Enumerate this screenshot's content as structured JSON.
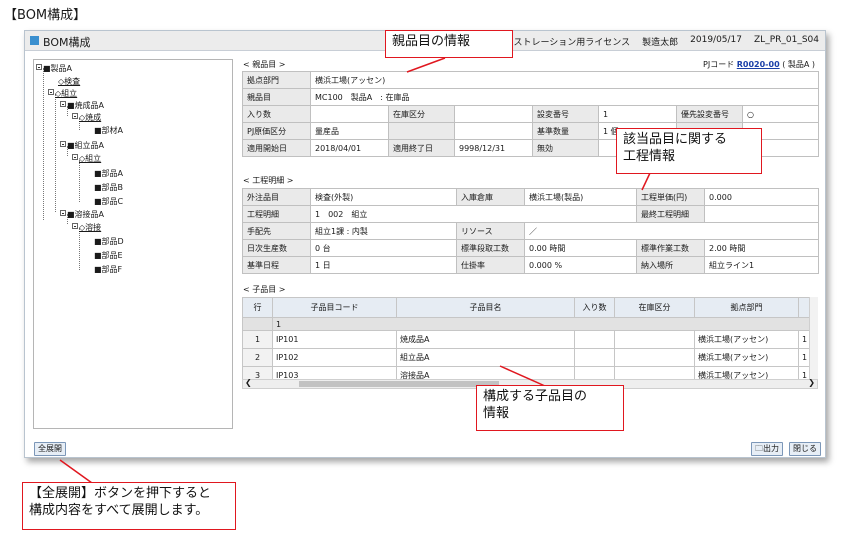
{
  "caption": "【BOM構成】",
  "window": {
    "title": "BOM構成",
    "license": "デモンストレーション用ライセンス",
    "user": "製造太郎",
    "date": "2019/05/17",
    "screen_id": "ZL_PR_01_S04"
  },
  "tree": [
    {
      "label": "■製品A",
      "link": false
    },
    {
      "label": "◇検査",
      "link": true
    },
    {
      "label": "◇組立",
      "link": true
    },
    {
      "label": "■焼成品A",
      "link": false
    },
    {
      "label": "◇焼成",
      "link": true
    },
    {
      "label": "■部材A",
      "link": false
    },
    {
      "label": "■組立品A",
      "link": false
    },
    {
      "label": "◇組立",
      "link": true
    },
    {
      "label": "■部品A",
      "link": false
    },
    {
      "label": "■部品B",
      "link": false
    },
    {
      "label": "■部品C",
      "link": false
    },
    {
      "label": "■溶接品A",
      "link": false
    },
    {
      "label": "◇溶接",
      "link": true
    },
    {
      "label": "■部品D",
      "link": false
    },
    {
      "label": "■部品E",
      "link": false
    },
    {
      "label": "■部品F",
      "link": false
    }
  ],
  "parent": {
    "section": "< 親品目 >",
    "pj_label": "PJコード",
    "pj_code": "R0020-00",
    "pj_suffix": "( 製品A )",
    "rows": [
      [
        "拠点部門",
        "横浜工場(アッセン)"
      ],
      [
        "親品目",
        "MC100　製品A　: 在庫品"
      ],
      [
        "入り数",
        "",
        "在庫区分",
        "",
        "設変番号",
        "1",
        "優先設変番号",
        "○"
      ],
      [
        "PJ原価区分",
        "量産品",
        "",
        "",
        "基準数量",
        "1 個",
        "",
        ""
      ],
      [
        "適用開始日",
        "2018/04/01",
        "適用終了日",
        "9998/12/31",
        "無効",
        "",
        "",
        ""
      ]
    ]
  },
  "process": {
    "section": "< 工程明細 >",
    "rows": [
      [
        "外注品目",
        "検査(外製)",
        "入庫倉庫",
        "横浜工場(製品)",
        "工程単価(円)",
        "0.000"
      ],
      [
        "工程明細",
        "1　002　組立",
        "",
        "",
        "最終工程明細",
        ""
      ],
      [
        "手配先",
        "組立1課 : 内製",
        "リソース",
        "／",
        "",
        ""
      ],
      [
        "日次生産数",
        "0 台",
        "標準段取工数",
        "0.00 時間",
        "標準作業工数",
        "2.00 時間"
      ],
      [
        "基準日程",
        "1 日",
        "仕掛率",
        "0.000 %",
        "納入場所",
        "組立ライン1"
      ]
    ]
  },
  "children": {
    "section": "< 子品目 >",
    "headers": [
      "行",
      "子品目コード",
      "子品目名",
      "入り数",
      "在庫区分",
      "拠点部門",
      ""
    ],
    "group_label": "1",
    "rows": [
      [
        "1",
        "IP101",
        "焼成品A",
        "",
        "",
        "横浜工場(アッセン)",
        "1"
      ],
      [
        "2",
        "IP102",
        "組立品A",
        "",
        "",
        "横浜工場(アッセン)",
        "1"
      ],
      [
        "3",
        "IP103",
        "溶接品A",
        "",
        "",
        "横浜工場(アッセン)",
        "1"
      ]
    ]
  },
  "buttons": {
    "expand_all": "全展開",
    "output": "出力",
    "close": "閉じる"
  },
  "annotations": {
    "parent_info": "親品目の情報",
    "process_info_line1": "該当品目に関する",
    "process_info_line2": "工程情報",
    "children_info_line1": "構成する子品目の",
    "children_info_line2": "情報",
    "expand_line1": "【全展開】ボタンを押下すると",
    "expand_line2": "構成内容をすべて展開します。"
  },
  "colors": {
    "annotation": "#e0171f",
    "accent": "#3a8fcf",
    "link": "#1a3fa8"
  }
}
